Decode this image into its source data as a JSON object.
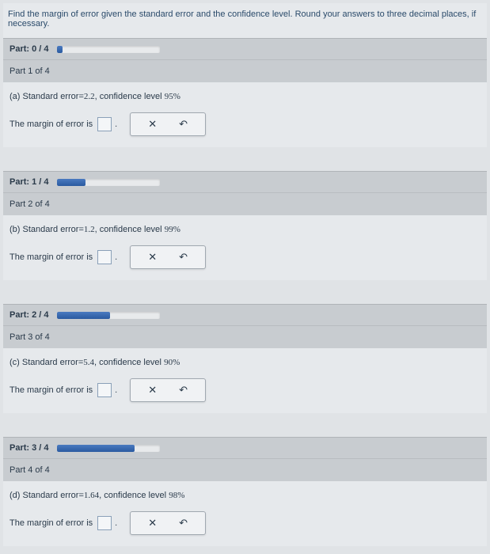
{
  "header": {
    "instruction": "Find the margin of error given the standard error and the confidence level. Round your answers to three decimal places, if necessary."
  },
  "parts": [
    {
      "progress_label": "Part: 0 / 4",
      "progress_fill": "6%",
      "title": "Part 1 of 4",
      "question_prefix": "(a) Standard error",
      "se_value": "2.2",
      "conf_text": ", confidence level",
      "conf_value": "95%",
      "answer_label": "The margin of error is",
      "dot": "."
    },
    {
      "progress_label": "Part: 1 / 4",
      "progress_fill": "28%",
      "title": "Part 2 of 4",
      "question_prefix": "(b) Standard error",
      "se_value": "1.2",
      "conf_text": ", confidence level",
      "conf_value": "99%",
      "answer_label": "The margin of error is",
      "dot": "."
    },
    {
      "progress_label": "Part: 2 / 4",
      "progress_fill": "52%",
      "title": "Part 3 of 4",
      "question_prefix": "(c) Standard error",
      "se_value": "5.4",
      "conf_text": ", confidence level",
      "conf_value": "90%",
      "answer_label": "The margin of error is",
      "dot": "."
    },
    {
      "progress_label": "Part: 3 / 4",
      "progress_fill": "76%",
      "title": "Part 4 of 4",
      "question_prefix": "(d) Standard error",
      "se_value": "1.64",
      "conf_text": ", confidence level",
      "conf_value": "98%",
      "answer_label": "The margin of error is",
      "dot": "."
    }
  ],
  "icons": {
    "clear": "✕",
    "reset": "↶"
  }
}
